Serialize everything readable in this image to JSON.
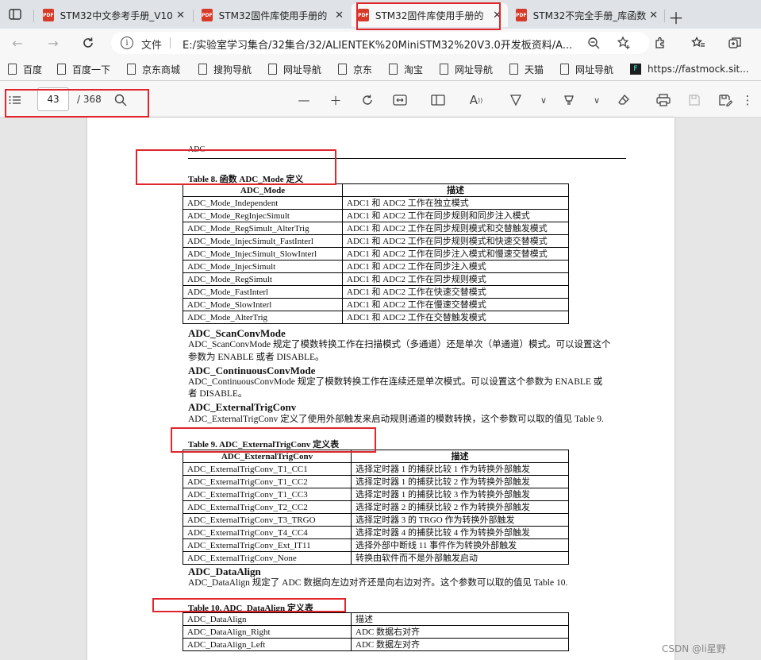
{
  "tabs": [
    {
      "label": "STM32中文参考手册_V10",
      "icon": "pdf-icon"
    },
    {
      "label": "STM32固件库使用手册的",
      "icon": "pdf-icon"
    },
    {
      "label": "STM32固件库使用手册的",
      "icon": "pdf-icon",
      "active": true
    },
    {
      "label": "STM32不完全手册_库函数",
      "icon": "pdf-icon"
    }
  ],
  "addressbar": {
    "scheme_label": "文件",
    "url": "E:/实验室学习集合/32集合/32/ALIENTEK%20MiniSTM32%20V3.0开发板资料/A..."
  },
  "bookmarks": [
    "百度",
    "百度一下",
    "京东商城",
    "搜狗导航",
    "网址导航",
    "京东",
    "淘宝",
    "网址导航",
    "天猫",
    "网址导航",
    "https://fastmock.sit..."
  ],
  "pdf_toolbar": {
    "page_current": "43",
    "page_total": "/ 368"
  },
  "document": {
    "running_header": "ADC",
    "table8": {
      "caption": "Table 8.  函数 ADC_Mode  定义",
      "headers": [
        "ADC_Mode",
        "描述"
      ],
      "rows": [
        [
          "ADC_Mode_Independent",
          "ADC1 和 ADC2 工作在独立模式"
        ],
        [
          "ADC_Mode_RegInjecSimult",
          "ADC1 和 ADC2 工作在同步规则和同步注入模式"
        ],
        [
          "ADC_Mode_RegSimult_AlterTrig",
          "ADC1 和 ADC2 工作在同步规则模式和交替触发模式"
        ],
        [
          "ADC_Mode_InjecSimult_FastInterl",
          "ADC1 和 ADC2 工作在同步规则模式和快速交替模式"
        ],
        [
          "ADC_Mode_InjecSimult_SlowInterl",
          "ADC1 和 ADC2 工作在同步注入模式和慢速交替模式"
        ],
        [
          "ADC_Mode_InjecSimult",
          "ADC1 和 ADC2 工作在同步注入模式"
        ],
        [
          "ADC_Mode_RegSimult",
          "ADC1 和 ADC2 工作在同步规则模式"
        ],
        [
          "ADC_Mode_FastInterl",
          "ADC1 和 ADC2 工作在快速交替模式"
        ],
        [
          "ADC_Mode_SlowInterl",
          "ADC1 和 ADC2 工作在慢速交替模式"
        ],
        [
          "ADC_Mode_AlterTrig",
          "ADC1 和 ADC2 工作在交替触发模式"
        ]
      ]
    },
    "scan_heading": "ADC_ScanConvMode",
    "scan_text_1": "ADC_ScanConvMode 规定了模数转换工作在扫描模式（多通道）还是单次（单通道）模式。可以设置这个",
    "scan_text_2": "参数为 ENABLE 或者 DISABLE。",
    "cont_heading": "ADC_ContinuousConvMode",
    "cont_text_1": "ADC_ContinuousConvMode 规定了模数转换工作在连续还是单次模式。可以设置这个参数为 ENABLE 或",
    "cont_text_2": "者 DISABLE。",
    "ext_heading": "ADC_ExternalTrigConv",
    "ext_text": "ADC_ExternalTrigConv 定义了使用外部触发来启动规则通道的模数转换，这个参数可以取的值见 Table 9.",
    "table9": {
      "caption": "Table 9. ADC_ExternalTrigConv 定义表",
      "headers": [
        "ADC_ExternalTrigConv",
        "描述"
      ],
      "rows": [
        [
          "ADC_ExternalTrigConv_T1_CC1",
          "选择定时器 1 的捕获比较 1 作为转换外部触发"
        ],
        [
          "ADC_ExternalTrigConv_T1_CC2",
          "选择定时器 1 的捕获比较 2 作为转换外部触发"
        ],
        [
          "ADC_ExternalTrigConv_T1_CC3",
          "选择定时器 1 的捕获比较 3 作为转换外部触发"
        ],
        [
          "ADC_ExternalTrigConv_T2_CC2",
          "选择定时器 2 的捕获比较 2 作为转换外部触发"
        ],
        [
          "ADC_ExternalTrigConv_T3_TRGO",
          "选择定时器 3 的 TRGO 作为转换外部触发"
        ],
        [
          "ADC_ExternalTrigConv_T4_CC4",
          "选择定时器 4 的捕获比较 4 作为转换外部触发"
        ],
        [
          "ADC_ExternalTrigConv_Ext_IT11",
          "选择外部中断线 11 事件作为转换外部触发"
        ],
        [
          "ADC_ExternalTrigConv_None",
          "转换由软件而不是外部触发启动"
        ]
      ]
    },
    "align_heading": "ADC_DataAlign",
    "align_text": "ADC_DataAlign 规定了 ADC 数据向左边对齐还是向右边对齐。这个参数可以取的值见 Table 10.",
    "table10": {
      "caption": "Table 10. ADC_DataAlign 定义表",
      "rows": [
        [
          "ADC_DataAlign",
          "描述"
        ],
        [
          "ADC_DataAlign_Right",
          "ADC 数据右对齐"
        ],
        [
          "ADC_DataAlign_Left",
          "ADC 数据左对齐"
        ]
      ]
    }
  },
  "watermark": "CSDN @li星野",
  "colors": {
    "annotation_red": "#e0262c",
    "pdf_icon": "#d63b2a"
  }
}
